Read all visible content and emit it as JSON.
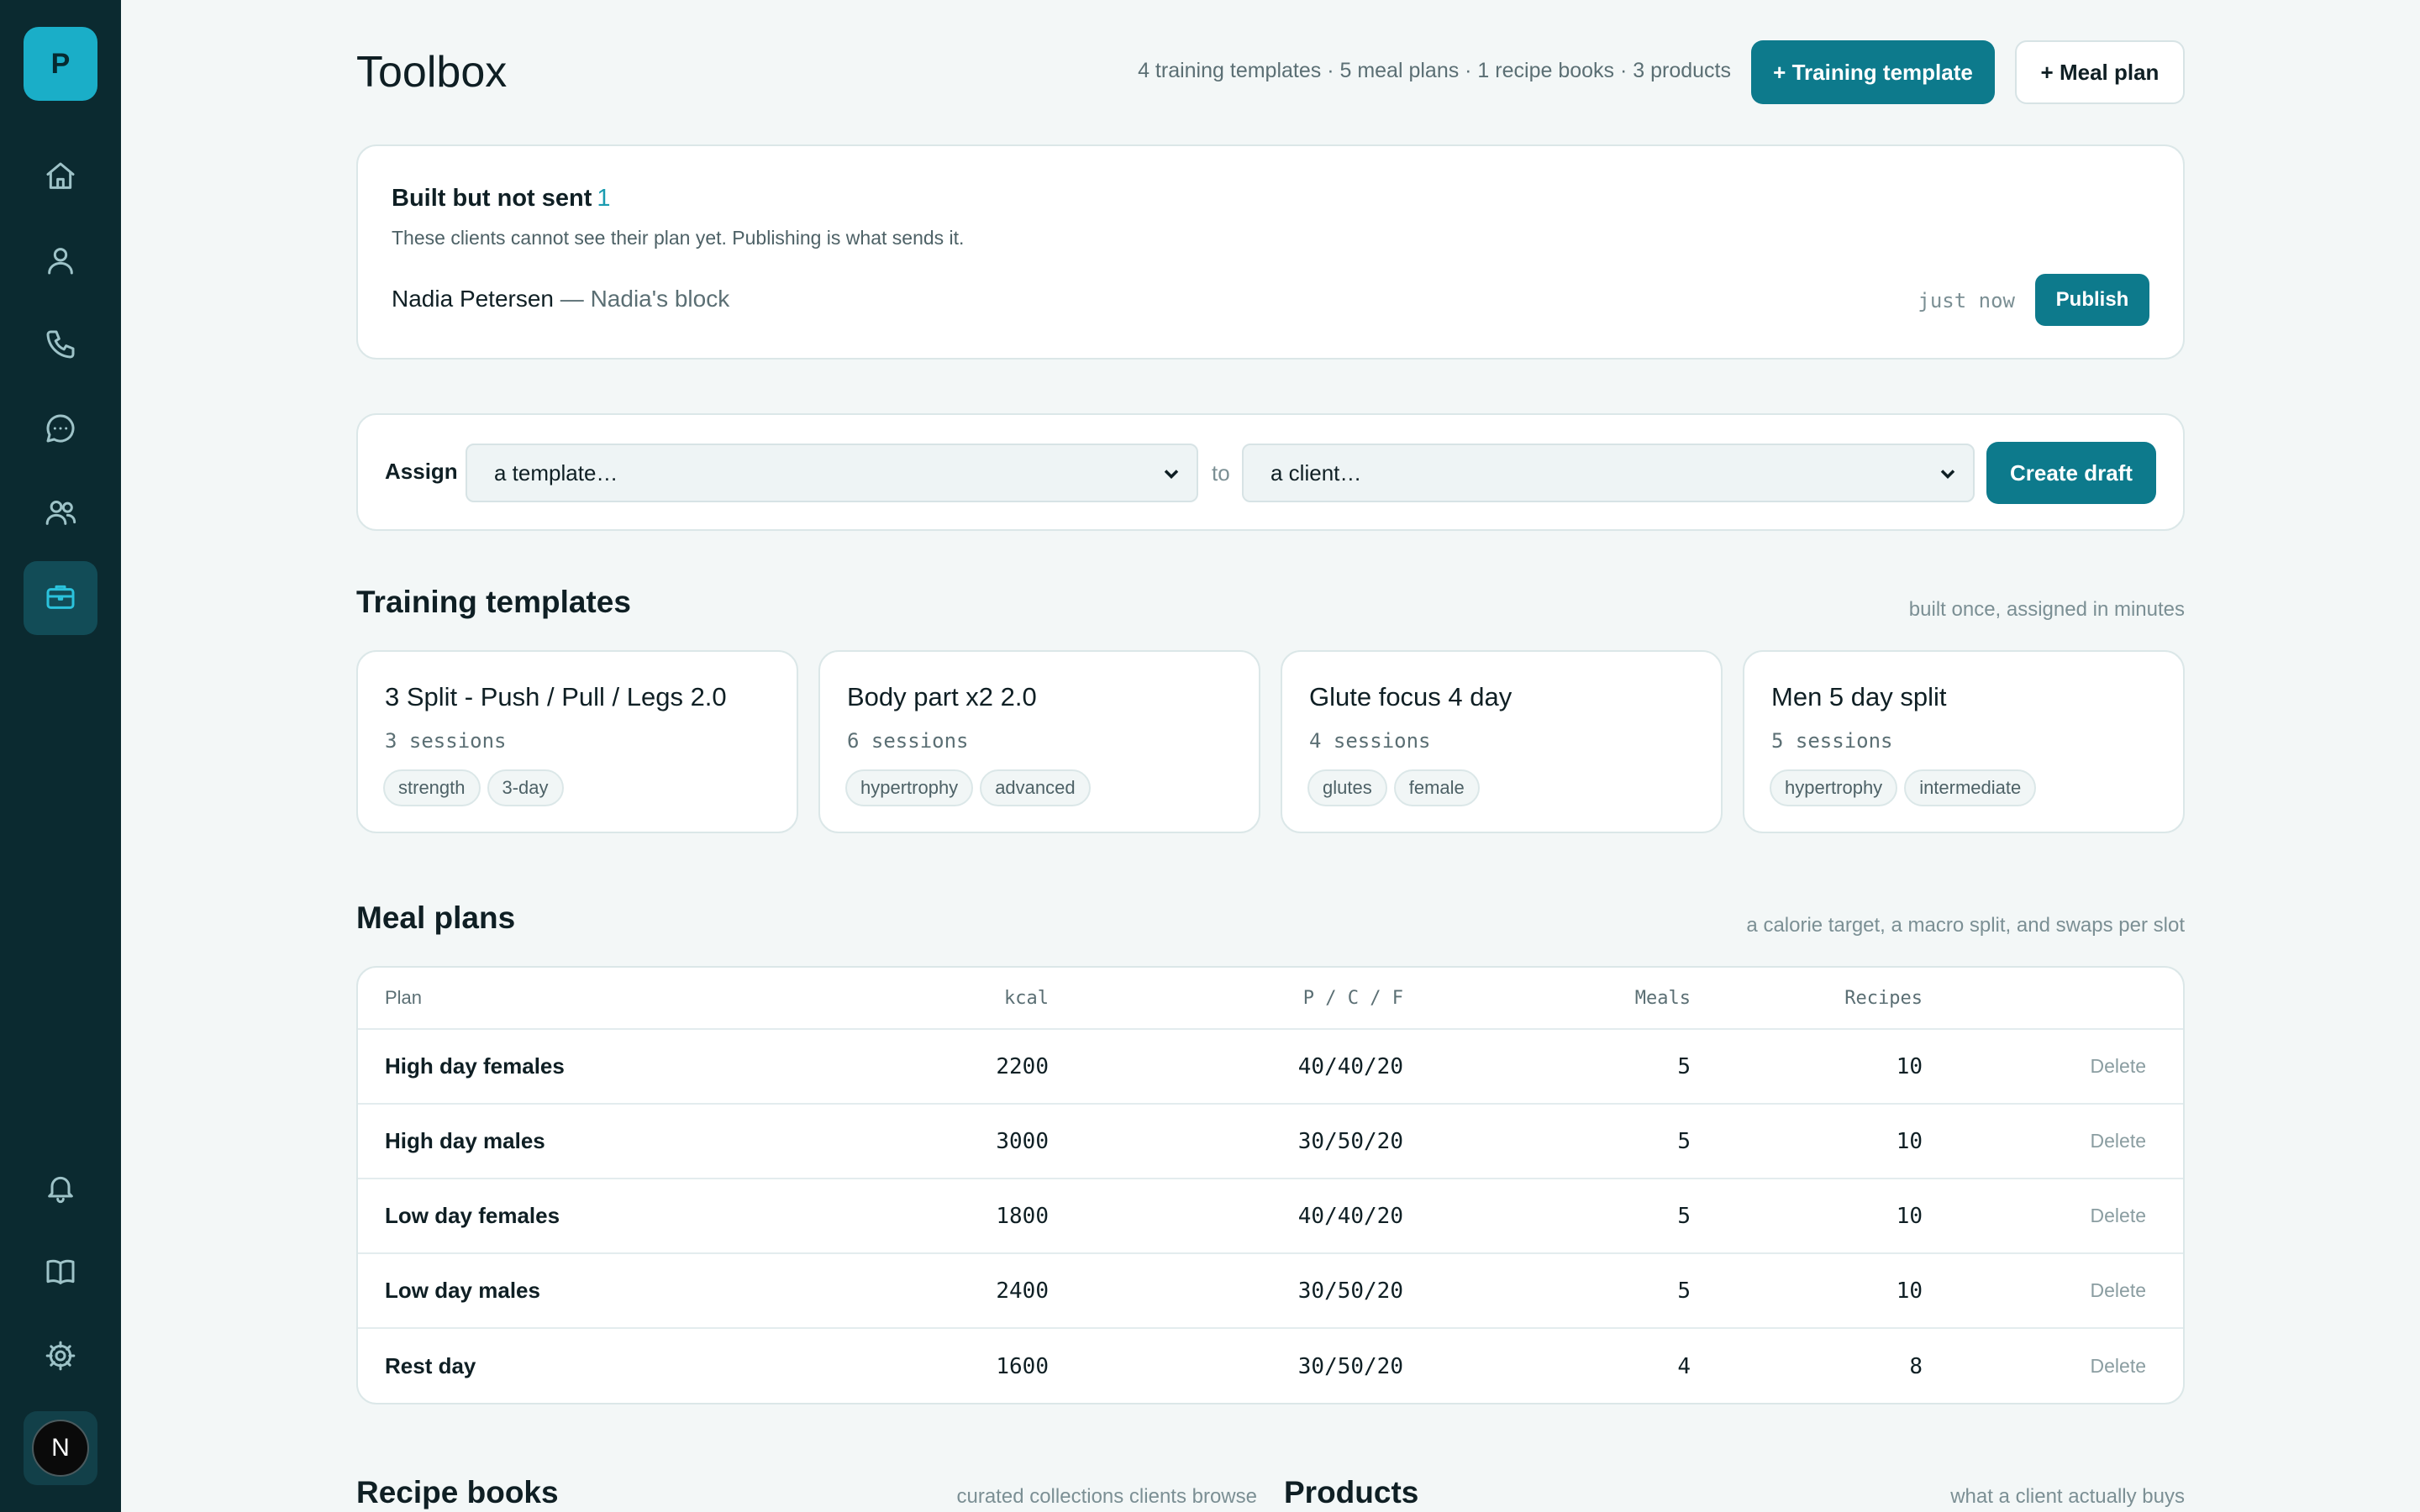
{
  "sidebar": {
    "logo": "P",
    "nav": [
      "home-icon",
      "user-icon",
      "phone-icon",
      "chat-icon",
      "users-icon",
      "briefcase-icon"
    ],
    "bottom": [
      "bell-icon",
      "book-icon",
      "gear-icon"
    ],
    "avatar": "N",
    "accent": "#2bc2dc"
  },
  "header": {
    "title": "Toolbox",
    "stats": "4 training templates · 5 meal plans · 1 recipe books · 3 products",
    "training_button": "+ Training template",
    "meal_button": "+ Meal plan"
  },
  "unsent": {
    "title": "Built but not sent",
    "count": "1",
    "description": "These clients cannot see their plan yet. Publishing is what sends it.",
    "client": "Nadia Petersen",
    "plan": " — Nadia's block",
    "time": "just now",
    "publish_label": "Publish"
  },
  "assign": {
    "label": "Assign",
    "template_value": "a template…",
    "to_label": "to",
    "client_value": "a client…",
    "button": "Create draft"
  },
  "training": {
    "title": "Training templates",
    "subtitle": "built once, assigned in minutes",
    "templates": [
      {
        "name": "3 Split - Push / Pull / Legs 2.0",
        "sessions": "3 sessions",
        "tags": [
          "strength",
          "3-day"
        ]
      },
      {
        "name": "Body part x2 2.0",
        "sessions": "6 sessions",
        "tags": [
          "hypertrophy",
          "advanced"
        ]
      },
      {
        "name": "Glute focus 4 day",
        "sessions": "4 sessions",
        "tags": [
          "glutes",
          "female"
        ]
      },
      {
        "name": "Men 5 day split",
        "sessions": "5 sessions",
        "tags": [
          "hypertrophy",
          "intermediate"
        ]
      }
    ]
  },
  "meals": {
    "title": "Meal plans",
    "subtitle": "a calorie target, a macro split, and swaps per slot",
    "columns": [
      "Plan",
      "kcal",
      "P / C / F",
      "Meals",
      "Recipes"
    ],
    "delete_label": "Delete",
    "rows": [
      {
        "plan": "High day females",
        "kcal": "2200",
        "pcf": "40/40/20",
        "meals": "5",
        "recipes": "10"
      },
      {
        "plan": "High day males",
        "kcal": "3000",
        "pcf": "30/50/20",
        "meals": "5",
        "recipes": "10"
      },
      {
        "plan": "Low day females",
        "kcal": "1800",
        "pcf": "40/40/20",
        "meals": "5",
        "recipes": "10"
      },
      {
        "plan": "Low day males",
        "kcal": "2400",
        "pcf": "30/50/20",
        "meals": "5",
        "recipes": "10"
      },
      {
        "plan": "Rest day",
        "kcal": "1600",
        "pcf": "30/50/20",
        "meals": "4",
        "recipes": "8"
      }
    ]
  },
  "recipes": {
    "title": "Recipe books",
    "subtitle": "curated collections clients browse"
  },
  "products": {
    "title": "Products",
    "subtitle": "what a client actually buys"
  }
}
